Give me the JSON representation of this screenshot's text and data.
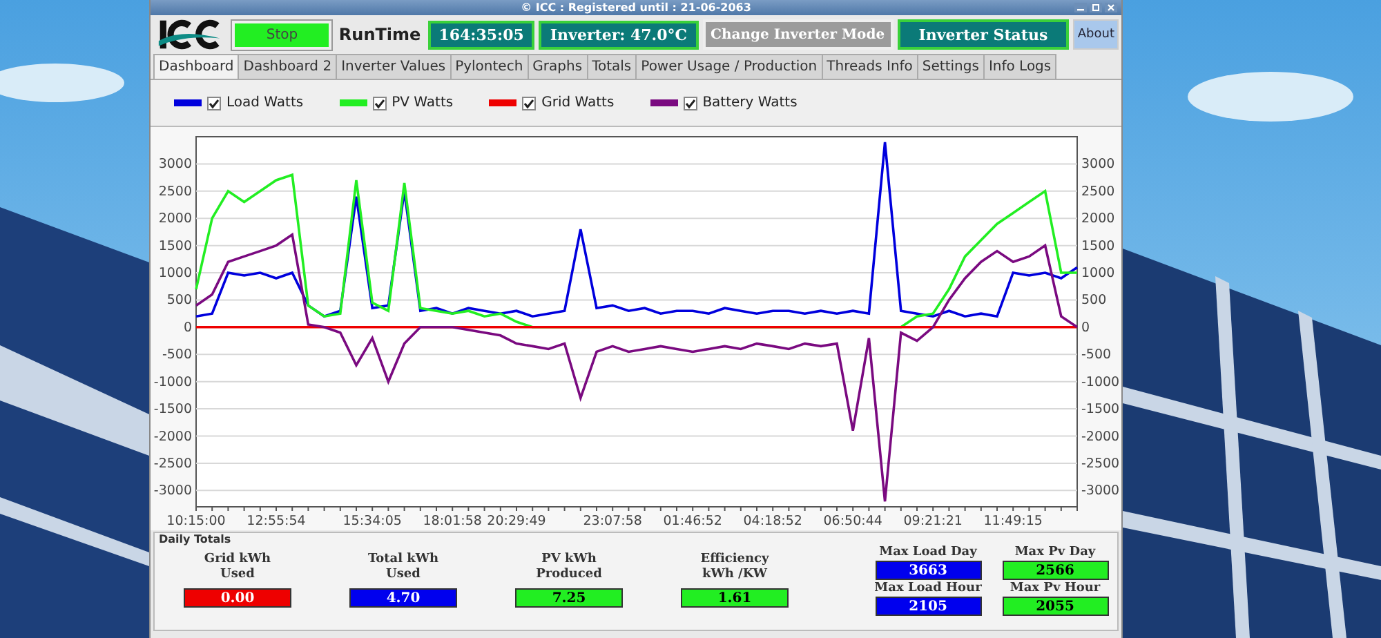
{
  "window": {
    "title": "© ICC : Registered until : 21-06-2063"
  },
  "toolbar": [
    {
      "kind": "state",
      "label": "Stop",
      "color": "#22ee22"
    },
    {
      "kind": "label",
      "label": "RunTime"
    },
    {
      "kind": "readout",
      "label": "164:35:05"
    },
    {
      "kind": "readout",
      "label": "Inverter: 47.0°C"
    },
    {
      "kind": "button",
      "label": "Change Inverter Mode",
      "disabled": true
    },
    {
      "kind": "button",
      "label": "Inverter Status",
      "disabled": false
    },
    {
      "kind": "small",
      "label": "About"
    }
  ],
  "tabs": [
    {
      "label": "Dashboard",
      "selected": true
    },
    {
      "label": "Dashboard 2",
      "selected": false
    },
    {
      "label": "Inverter Values",
      "selected": false
    },
    {
      "label": "Pylontech",
      "selected": false
    },
    {
      "label": "Graphs",
      "selected": false
    },
    {
      "label": "Totals",
      "selected": false
    },
    {
      "label": "Power Usage / Production",
      "selected": false
    },
    {
      "label": "Threads Info",
      "selected": false
    },
    {
      "label": "Settings",
      "selected": false
    },
    {
      "label": "Info Logs",
      "selected": false
    }
  ],
  "chart": {
    "legend": [
      {
        "checked": true
      },
      {
        "checked": true
      },
      {
        "checked": true
      },
      {
        "checked": true
      }
    ],
    "right_axis_labels": [
      "3000",
      "2500",
      "2000",
      "1500",
      "1000",
      "500",
      "0",
      "-500",
      "-1000",
      "-1500",
      "-2000",
      "-2500",
      "-3000"
    ],
    "chart_data": {
      "type": "line",
      "grid": true,
      "ylim": [
        -3300,
        3500
      ],
      "yticks": [
        -3000,
        -2500,
        -2000,
        -1500,
        -1000,
        -500,
        0,
        500,
        1000,
        1500,
        2000,
        2500,
        3000
      ],
      "categories": [
        "10:15:00",
        null,
        null,
        null,
        null,
        "12:55:54",
        null,
        null,
        null,
        null,
        null,
        "15:34:05",
        null,
        null,
        null,
        null,
        "18:01:58",
        null,
        null,
        null,
        "20:29:49",
        null,
        null,
        null,
        null,
        null,
        "23:07:58",
        null,
        null,
        null,
        null,
        "01:46:52",
        null,
        null,
        null,
        null,
        "04:18:52",
        null,
        null,
        null,
        null,
        "06:50:44",
        null,
        null,
        null,
        null,
        "09:21:21",
        null,
        null,
        null,
        null,
        "11:49:15",
        null,
        null,
        null,
        null
      ],
      "series": [
        {
          "name": "Load Watts",
          "color": "#0000dd",
          "values": [
            200,
            250,
            1000,
            950,
            1000,
            900,
            1000,
            400,
            200,
            300,
            2400,
            350,
            400,
            2500,
            300,
            350,
            250,
            350,
            300,
            250,
            300,
            200,
            250,
            300,
            1800,
            350,
            400,
            300,
            350,
            250,
            300,
            300,
            250,
            350,
            300,
            250,
            300,
            300,
            250,
            300,
            250,
            300,
            250,
            3400,
            300,
            250,
            200,
            300,
            200,
            250,
            200,
            1000,
            950,
            1000,
            900,
            1100
          ]
        },
        {
          "name": "PV Watts",
          "color": "#22ee22",
          "values": [
            700,
            2000,
            2500,
            2300,
            2500,
            2700,
            2800,
            400,
            200,
            250,
            2700,
            450,
            300,
            2650,
            350,
            300,
            250,
            300,
            200,
            250,
            100,
            0,
            0,
            0,
            0,
            0,
            0,
            0,
            0,
            0,
            0,
            0,
            0,
            0,
            0,
            0,
            0,
            0,
            0,
            0,
            0,
            0,
            0,
            0,
            0,
            200,
            250,
            700,
            1300,
            1600,
            1900,
            2100,
            2300,
            2500,
            1000,
            1000
          ]
        },
        {
          "name": "Grid Watts",
          "color": "#ee0000",
          "values": [
            0,
            0,
            0,
            0,
            0,
            0,
            0,
            0,
            0,
            0,
            0,
            0,
            0,
            0,
            0,
            0,
            0,
            0,
            0,
            0,
            0,
            0,
            0,
            0,
            0,
            0,
            0,
            0,
            0,
            0,
            0,
            0,
            0,
            0,
            0,
            0,
            0,
            0,
            0,
            0,
            0,
            0,
            0,
            0,
            0,
            0,
            0,
            0,
            0,
            0,
            0,
            0,
            0,
            0,
            0,
            0
          ]
        },
        {
          "name": "Battery Watts",
          "color": "#7a0a80",
          "values": [
            400,
            600,
            1200,
            1300,
            1400,
            1500,
            1700,
            50,
            0,
            -100,
            -700,
            -200,
            -1000,
            -300,
            0,
            0,
            0,
            -50,
            -100,
            -150,
            -300,
            -350,
            -400,
            -300,
            -1300,
            -450,
            -350,
            -450,
            -400,
            -350,
            -400,
            -450,
            -400,
            -350,
            -400,
            -300,
            -350,
            -400,
            -300,
            -350,
            -300,
            -1900,
            -200,
            -3200,
            -100,
            -250,
            0,
            500,
            900,
            1200,
            1400,
            1200,
            1300,
            1500,
            200,
            0
          ]
        }
      ]
    }
  },
  "daily_totals": {
    "title": "Daily Totals",
    "stats": [
      {
        "label": "Grid kWh\nUsed",
        "value": "0.00",
        "color": "#ee0000"
      },
      {
        "label": "Total kWh\nUsed",
        "value": "4.70",
        "color": "#0000ee"
      },
      {
        "label": "PV kWh\nProduced",
        "value": "7.25",
        "color": "#22ee22"
      },
      {
        "label": "Efficiency\nkWh /KW",
        "value": "1.61",
        "color": "#22ee22"
      }
    ],
    "maxima": [
      {
        "label": "Max Load Day",
        "value": "3663",
        "color": "#0000ee"
      },
      {
        "label": "Max Pv Day",
        "value": "2566",
        "color": "#22ee22"
      },
      {
        "label": "Max Load Hour",
        "value": "2105",
        "color": "#0000ee"
      },
      {
        "label": "Max Pv Hour",
        "value": "2055",
        "color": "#22ee22"
      }
    ]
  }
}
